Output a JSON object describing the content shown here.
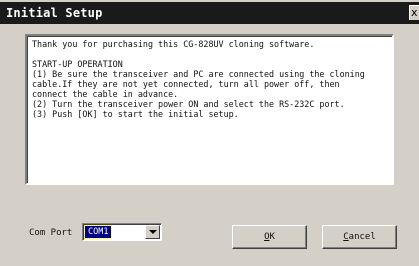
{
  "window": {
    "title": "Initial Setup",
    "close_glyph": "x"
  },
  "message": {
    "text": "Thank you for purchasing this CG-828UV cloning software.\n\nSTART-UP OPERATION\n(1) Be sure the transceiver and PC are connected using the cloning\ncable.If they are not yet connected, turn all power off, then\nconnect the cable in advance.\n(2) Turn the transceiver power ON and select the RS-232C port.\n(3) Push [OK] to start the initial setup."
  },
  "com_port": {
    "label": "Com Port",
    "selected": "COM1"
  },
  "buttons": {
    "ok": {
      "accel": "O",
      "rest": "K"
    },
    "cancel": {
      "accel": "C",
      "rest": "ancel"
    }
  }
}
